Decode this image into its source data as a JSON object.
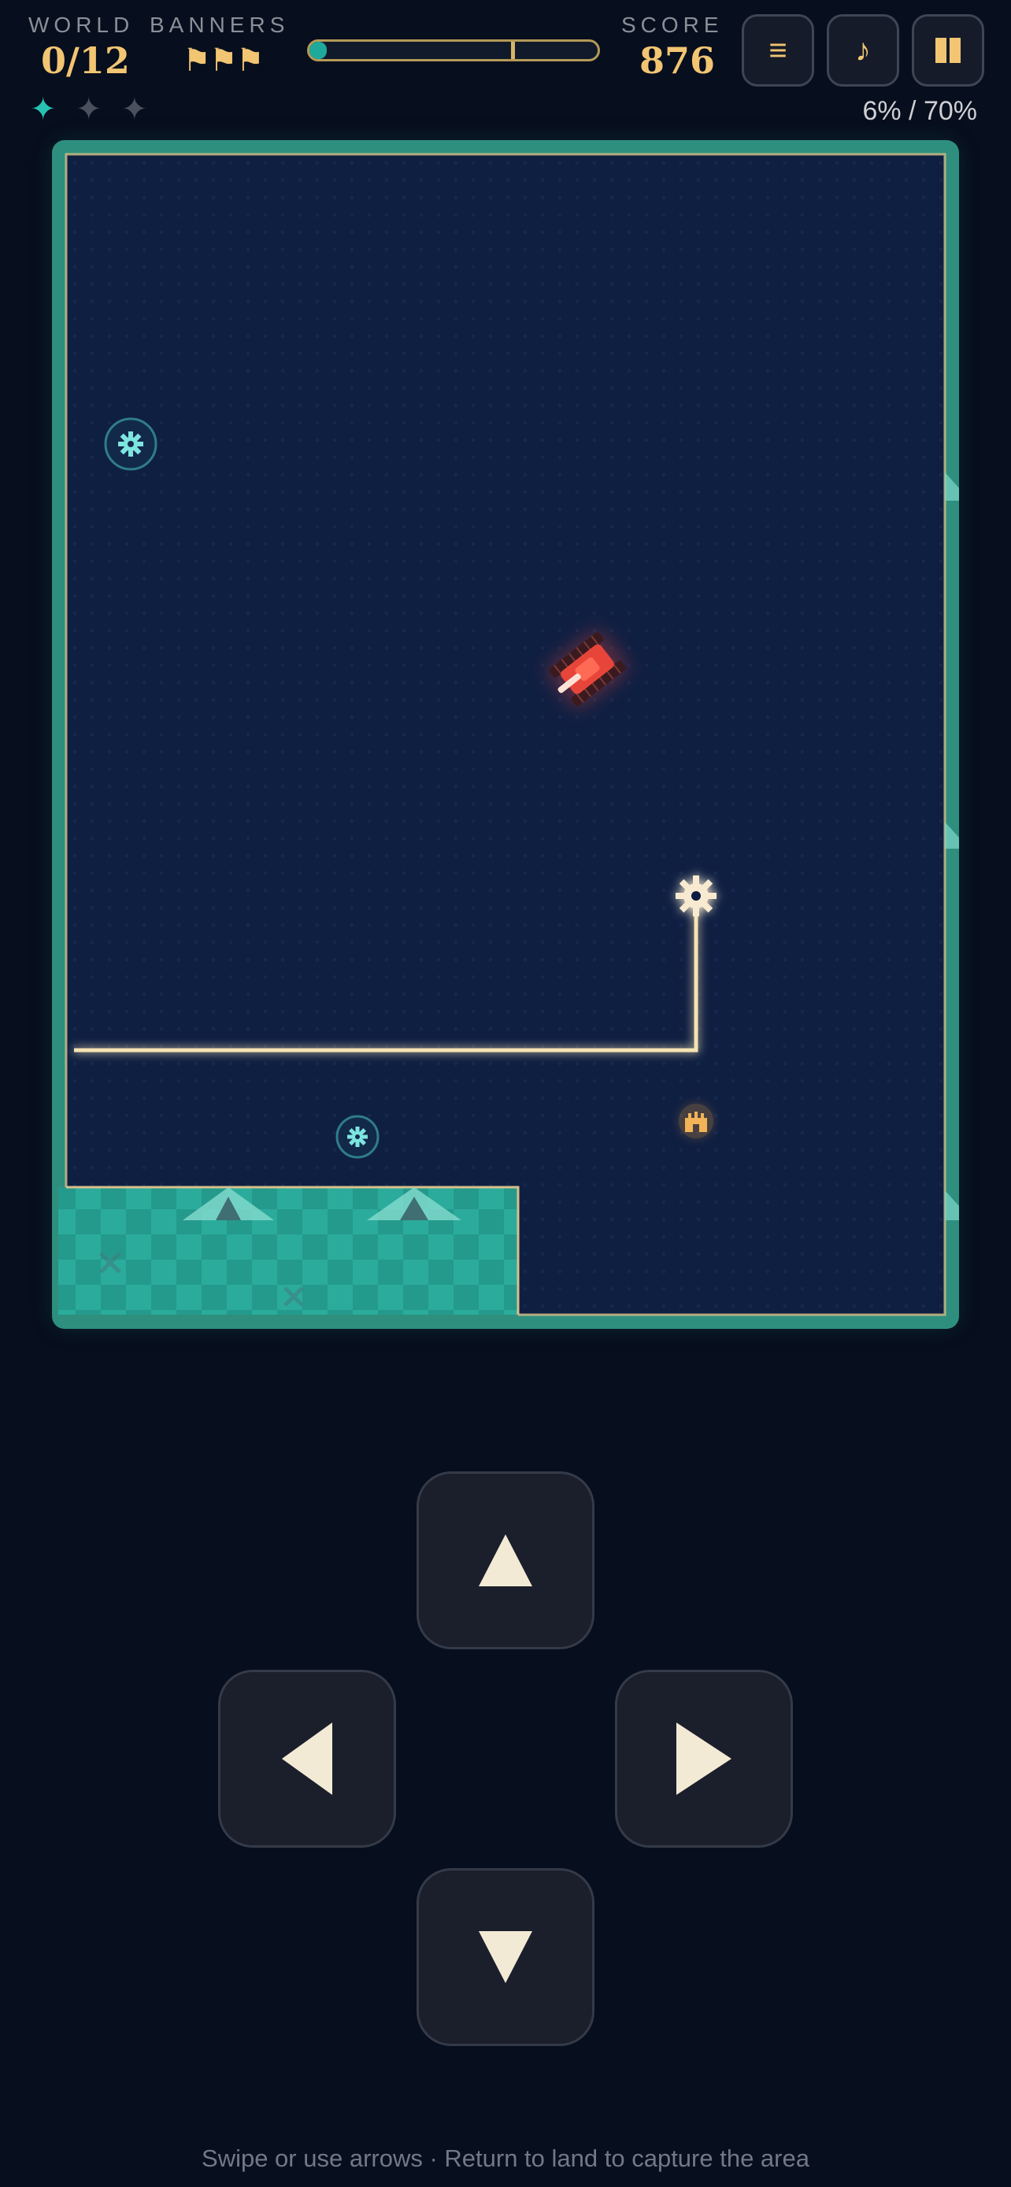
{
  "hud": {
    "world_label": "WORLD",
    "world_value": "0/12",
    "banners_label": "BANNERS",
    "banners_value": "⚑⚑⚑",
    "score_label": "SCORE",
    "score_value": "876",
    "progress_fraction": 0.06,
    "target_fraction": 0.7,
    "capture_text": "6% / 70%",
    "stars": {
      "earned": 1,
      "total": 3,
      "symbol": "✦"
    },
    "buttons": {
      "menu_icon": "≡",
      "music_icon": "♪"
    }
  },
  "board": {
    "icons": [
      "gear-icon",
      "gear-icon",
      "gear-icon",
      "castle-icon"
    ],
    "enemy": "red-tank"
  },
  "controls": {
    "up": "up-arrow-icon",
    "left": "left-arrow-icon",
    "right": "right-arrow-icon",
    "down": "down-arrow-icon"
  },
  "hint": "Swipe or use arrows · Return to land to capture the area",
  "colors": {
    "accent_gold": "#f2c572",
    "land_teal": "#2aa597",
    "sea_navy": "#0f1f42",
    "trail": "#f5e3b3",
    "enemy_red": "#e8453a"
  }
}
